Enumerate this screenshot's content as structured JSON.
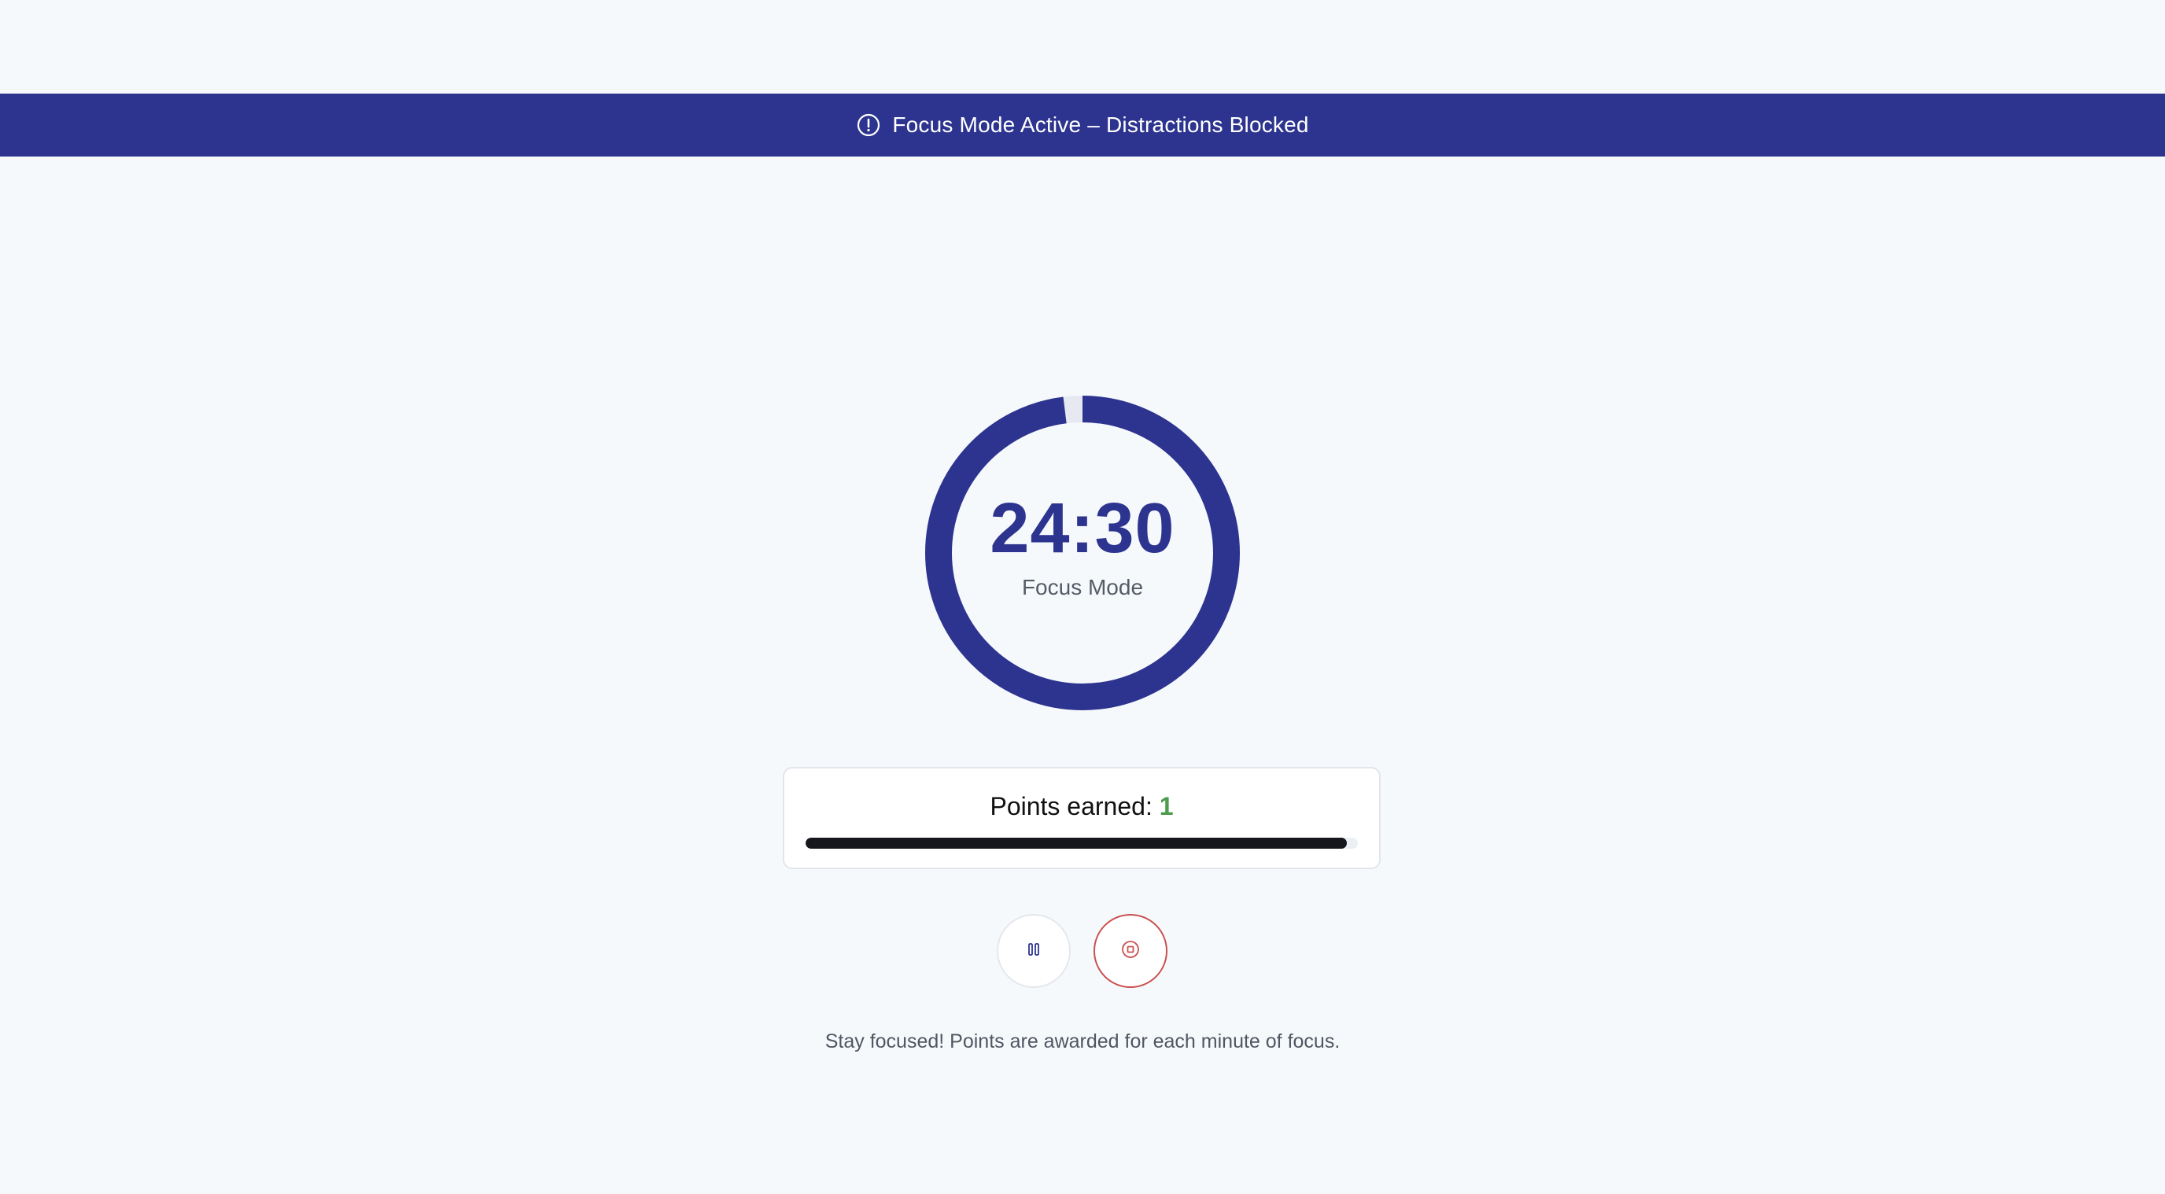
{
  "banner": {
    "text": "Focus Mode Active – Distractions Blocked",
    "icon": "alert-circle-icon",
    "background": "#2d348f"
  },
  "timer": {
    "time": "24:30",
    "mode_label": "Focus Mode",
    "ring_progress_fraction": 0.98,
    "accent": "#2d348f"
  },
  "points": {
    "label": "Points earned: ",
    "value": "1",
    "progress_percent": 98,
    "value_color": "#4e9b4e"
  },
  "controls": {
    "pause_icon": "pause-icon",
    "stop_icon": "stop-icon",
    "stop_color": "#c95050"
  },
  "hint": "Stay focused! Points are awarded for each minute of focus."
}
